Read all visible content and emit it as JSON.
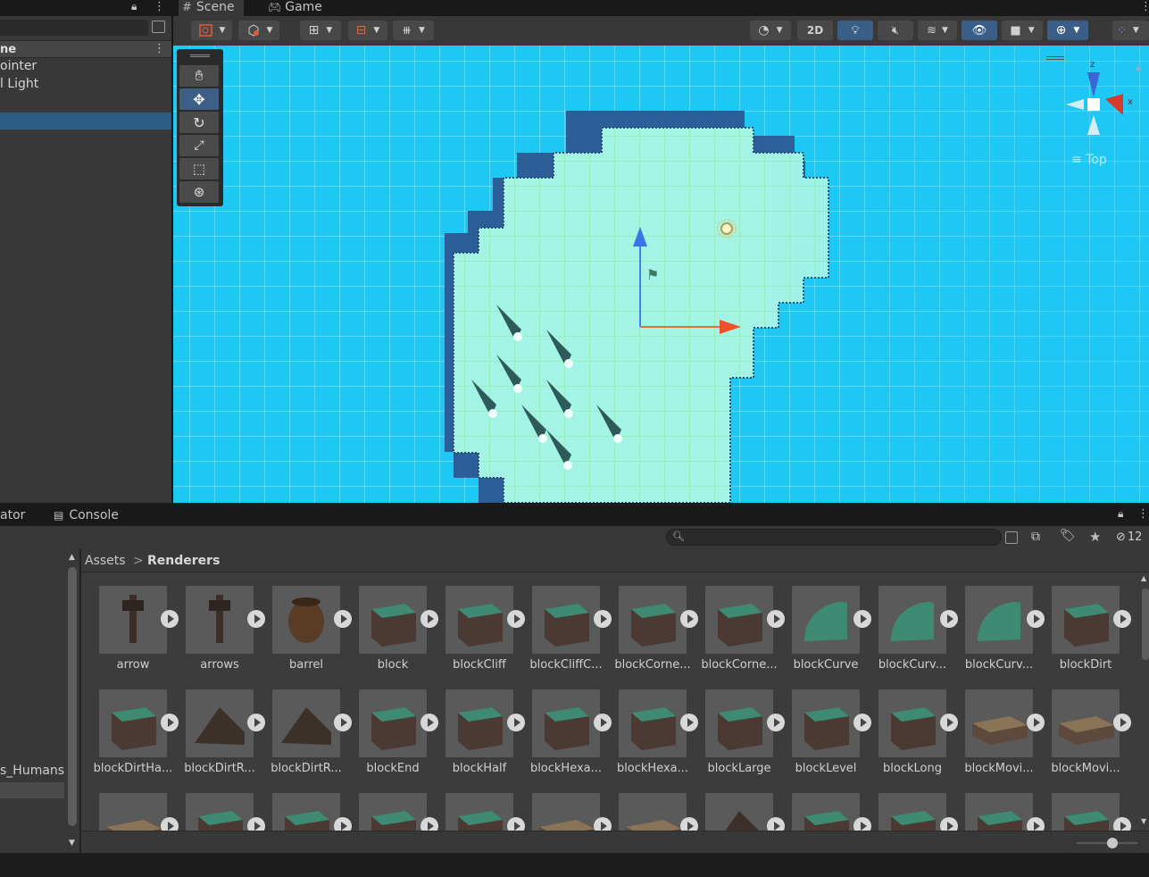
{
  "hierarchy": {
    "header_fragment": "ne",
    "items": [
      "ointer",
      "l Light"
    ],
    "selected_row": ""
  },
  "scene_tabs": {
    "scene": "Scene",
    "game": "Game"
  },
  "scene_toolbar": {
    "mode_2d": "2D"
  },
  "gizmo": {
    "z": "z",
    "x": "x",
    "view": "Top"
  },
  "bottom_tabs": {
    "animator_fragment": "ator",
    "console": "Console"
  },
  "project": {
    "left_item": "s_Humans",
    "breadcrumb": {
      "root": "Assets",
      "sep": ">",
      "current": "Renderers"
    },
    "hidden_count_fragment": "12",
    "row1": [
      "arrow",
      "arrows",
      "barrel",
      "block",
      "blockCliff",
      "blockCliffC...",
      "blockCorne...",
      "blockCorne...",
      "blockCurve",
      "blockCurv...",
      "blockCurv...",
      "blockDirt"
    ],
    "row2": [
      "blockDirtHa...",
      "blockDirtR...",
      "blockDirtR...",
      "blockEnd",
      "blockHalf",
      "blockHexa...",
      "blockHexa...",
      "blockLarge",
      "blockLevel",
      "blockLong",
      "blockMovi...",
      "blockMovi..."
    ]
  },
  "colors": {
    "scene_sky": "#1ec8f5",
    "floor": "#a4f4e6",
    "selection_blue": "#2c5d87",
    "grass": "#3f8a72",
    "dirt": "#4a3a33"
  }
}
